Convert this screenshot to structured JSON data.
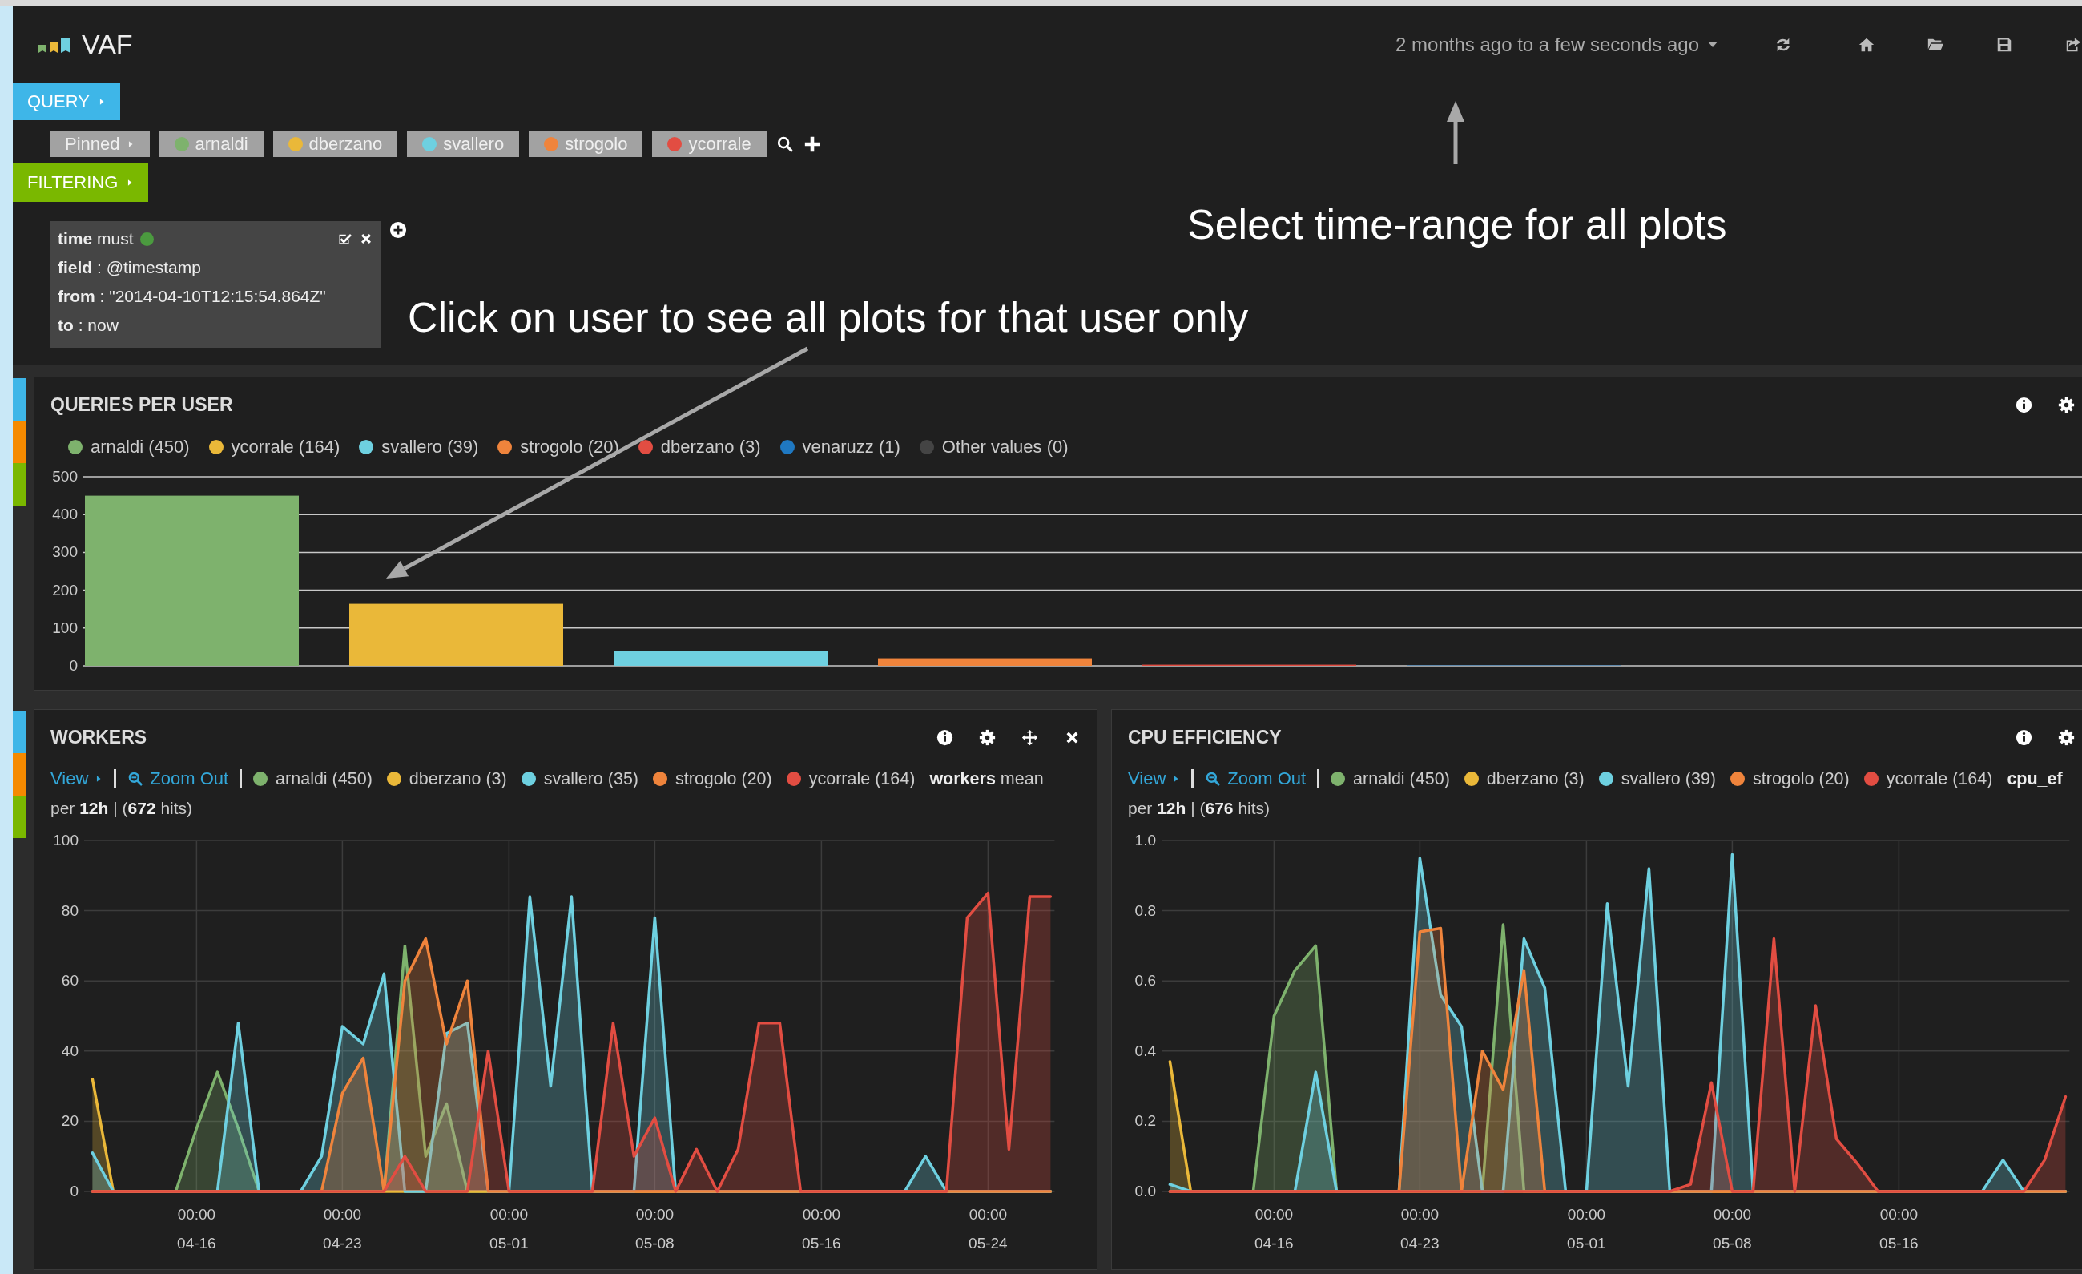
{
  "header": {
    "logo_text": "VAF",
    "time_range": "2 months ago to a few seconds ago"
  },
  "query": {
    "label": "QUERY"
  },
  "pinned": {
    "label": "Pinned",
    "queries": [
      {
        "label": "arnaldi",
        "color": "#7eb26d"
      },
      {
        "label": "dberzano",
        "color": "#eab839"
      },
      {
        "label": "svallero",
        "color": "#6ed0e0"
      },
      {
        "label": "strogolo",
        "color": "#ef843c"
      },
      {
        "label": "ycorrale",
        "color": "#e24d42"
      }
    ]
  },
  "filtering": {
    "label": "FILTERING"
  },
  "filters": [
    {
      "heading": "**time** must",
      "color": "#4b9a3f",
      "lines": [
        "**field** : @timestamp",
        "**from** : \"2014-04-10T12:15:54.864Z\"",
        "**to** : now"
      ]
    }
  ],
  "callouts": [
    {
      "text": "Select time-range for all plots"
    },
    {
      "text": "Click on user to see all plots for that user only"
    }
  ],
  "rows": [
    {
      "handles": [
        {
          "color": "#3eb6e8"
        },
        {
          "color": "#f58a00"
        },
        {
          "color": "#7ab800"
        }
      ],
      "panels": [
        {
          "kind": "bar",
          "title": "QUERIES PER USER",
          "hovered": false,
          "legend": [
            {
              "label": "arnaldi (450)",
              "color": "#7eb26d"
            },
            {
              "label": "ycorrale (164)",
              "color": "#eab839"
            },
            {
              "label": "svallero (39)",
              "color": "#6ed0e0"
            },
            {
              "label": "strogolo (20)",
              "color": "#ef843c"
            },
            {
              "label": "dberzano (3)",
              "color": "#e24d42"
            },
            {
              "label": "venaruzz (1)",
              "color": "#1f78c1"
            },
            {
              "label": "Other values (0)",
              "color": "#444444"
            }
          ],
          "chart_data": {
            "type": "bar",
            "grid": true,
            "values": [
              450,
              164,
              39,
              20,
              3,
              1,
              0
            ],
            "ylim": [
              0,
              500
            ],
            "yticks": [
              0,
              100,
              200,
              300,
              400,
              500
            ]
          }
        }
      ]
    },
    {
      "handles": [
        {
          "color": "#3eb6e8"
        },
        {
          "color": "#f58a00"
        },
        {
          "color": "#7ab800"
        }
      ],
      "panels": [
        {
          "kind": "histogram",
          "title": "WORKERS",
          "hovered": true,
          "view_label": "View",
          "zoom_label": "Zoom Out",
          "legend": [
            {
              "label": "arnaldi (450)",
              "color": "#7eb26d"
            },
            {
              "label": "dberzano (3)",
              "color": "#eab839"
            },
            {
              "label": "svallero (35)",
              "color": "#6ed0e0"
            },
            {
              "label": "strogolo (20)",
              "color": "#ef843c"
            },
            {
              "label": "ycorrale (164)",
              "color": "#e24d42"
            }
          ],
          "metric_text": "**workers** mean",
          "interval_text": "per **12h** | (**672** hits)",
          "chart_data": {
            "type": "area",
            "grid": true,
            "categories": [
              null,
              null,
              null,
              null,
              null,
              "00:00 04-16",
              null,
              null,
              null,
              null,
              null,
              null,
              "00:00 04-23",
              null,
              null,
              null,
              null,
              null,
              null,
              null,
              "00:00 05-01",
              null,
              null,
              null,
              null,
              null,
              null,
              "00:00 05-08",
              null,
              null,
              null,
              null,
              null,
              null,
              null,
              "00:00 05-16",
              null,
              null,
              null,
              null,
              null,
              null,
              null,
              "00:00 05-24",
              null,
              null,
              null
            ],
            "ylim": [
              0,
              100
            ],
            "yticks": [
              0,
              20,
              40,
              60,
              80,
              100
            ],
            "series": [
              {
                "color": "#7eb26d",
                "values": [
                  0,
                  0,
                  0,
                  0,
                  0,
                  18,
                  34,
                  18,
                  0,
                  0,
                  0,
                  0,
                  0,
                  0,
                  0,
                  70,
                  10,
                  25,
                  0,
                  0,
                  0,
                  0,
                  0,
                  0,
                  0,
                  0,
                  0,
                  0,
                  0,
                  0,
                  0,
                  0,
                  0,
                  0,
                  0,
                  0,
                  0,
                  0,
                  0,
                  0,
                  0,
                  0,
                  0,
                  0,
                  0,
                  0,
                  0
                ]
              },
              {
                "color": "#eab839",
                "values": [
                  32,
                  0,
                  0,
                  0,
                  0,
                  0,
                  0,
                  0,
                  0,
                  0,
                  0,
                  0,
                  0,
                  0,
                  0,
                  0,
                  0,
                  0,
                  0,
                  0,
                  0,
                  0,
                  0,
                  0,
                  0,
                  0,
                  0,
                  0,
                  0,
                  0,
                  0,
                  0,
                  0,
                  0,
                  0,
                  0,
                  0,
                  0,
                  0,
                  0,
                  0,
                  0,
                  0,
                  0,
                  0,
                  0,
                  0
                ]
              },
              {
                "color": "#6ed0e0",
                "values": [
                  11,
                  0,
                  0,
                  0,
                  0,
                  0,
                  0,
                  48,
                  0,
                  0,
                  0,
                  10,
                  47,
                  42,
                  62,
                  0,
                  0,
                  45,
                  48,
                  0,
                  0,
                  84,
                  30,
                  84,
                  0,
                  0,
                  0,
                  78,
                  0,
                  0,
                  0,
                  0,
                  0,
                  0,
                  0,
                  0,
                  0,
                  0,
                  0,
                  0,
                  10,
                  0,
                  0,
                  0,
                  0,
                  0,
                  0
                ]
              },
              {
                "color": "#ef843c",
                "values": [
                  0,
                  0,
                  0,
                  0,
                  0,
                  0,
                  0,
                  0,
                  0,
                  0,
                  0,
                  0,
                  28,
                  38,
                  0,
                  60,
                  72,
                  42,
                  60,
                  0,
                  0,
                  0,
                  0,
                  0,
                  0,
                  0,
                  0,
                  0,
                  0,
                  0,
                  0,
                  0,
                  0,
                  0,
                  0,
                  0,
                  0,
                  0,
                  0,
                  0,
                  0,
                  0,
                  0,
                  0,
                  0,
                  0,
                  0
                ]
              },
              {
                "color": "#e24d42",
                "values": [
                  0,
                  0,
                  0,
                  0,
                  0,
                  0,
                  0,
                  0,
                  0,
                  0,
                  0,
                  0,
                  0,
                  0,
                  0,
                  10,
                  0,
                  0,
                  0,
                  40,
                  0,
                  0,
                  0,
                  0,
                  0,
                  48,
                  10,
                  21,
                  0,
                  12,
                  0,
                  12,
                  48,
                  48,
                  0,
                  0,
                  0,
                  0,
                  0,
                  0,
                  0,
                  0,
                  78,
                  85,
                  12,
                  84,
                  84
                ]
              }
            ]
          }
        },
        {
          "kind": "histogram",
          "title": "CPU EFFICIENCY",
          "hovered": false,
          "view_label": "View",
          "zoom_label": "Zoom Out",
          "legend": [
            {
              "label": "arnaldi (450)",
              "color": "#7eb26d"
            },
            {
              "label": "dberzano (3)",
              "color": "#eab839"
            },
            {
              "label": "svallero (39)",
              "color": "#6ed0e0"
            },
            {
              "label": "strogolo (20)",
              "color": "#ef843c"
            },
            {
              "label": "ycorrale (164)",
              "color": "#e24d42"
            }
          ],
          "metric_text": "**cpu_ef**",
          "interval_text": "per **12h** | (**676** hits)",
          "chart_data": {
            "type": "area",
            "grid": true,
            "categories": [
              null,
              null,
              null,
              null,
              null,
              "00:00 04-16",
              null,
              null,
              null,
              null,
              null,
              null,
              "00:00 04-23",
              null,
              null,
              null,
              null,
              null,
              null,
              null,
              "00:00 05-01",
              null,
              null,
              null,
              null,
              null,
              null,
              "00:00 05-08",
              null,
              null,
              null,
              null,
              null,
              null,
              null,
              "00:00 05-16",
              null,
              null,
              null,
              null,
              null,
              null,
              null,
              null
            ],
            "ylim": [
              0,
              1
            ],
            "yticks": [
              {
                "value": 0,
                "label": "0.0"
              },
              {
                "value": 0.2,
                "label": "0.2"
              },
              {
                "value": 0.4,
                "label": "0.4"
              },
              {
                "value": 0.6,
                "label": "0.6"
              },
              {
                "value": 0.8,
                "label": "0.8"
              },
              {
                "value": 1,
                "label": "1.0"
              }
            ],
            "series": [
              {
                "color": "#7eb26d",
                "values": [
                  0,
                  0,
                  0,
                  0,
                  0,
                  0.5,
                  0.63,
                  0.7,
                  0,
                  0,
                  0,
                  0,
                  0,
                  0,
                  0,
                  0,
                  0.76,
                  0,
                  0,
                  0,
                  0,
                  0,
                  0,
                  0,
                  0,
                  0,
                  0,
                  0,
                  0,
                  0,
                  0,
                  0,
                  0,
                  0,
                  0,
                  0,
                  0,
                  0,
                  0,
                  0,
                  0,
                  0,
                  0,
                  0
                ]
              },
              {
                "color": "#eab839",
                "values": [
                  0.37,
                  0,
                  0,
                  0,
                  0,
                  0,
                  0,
                  0,
                  0,
                  0,
                  0,
                  0,
                  0,
                  0,
                  0,
                  0,
                  0,
                  0,
                  0,
                  0,
                  0,
                  0,
                  0,
                  0,
                  0,
                  0,
                  0,
                  0,
                  0,
                  0,
                  0,
                  0,
                  0,
                  0,
                  0,
                  0,
                  0,
                  0,
                  0,
                  0,
                  0,
                  0,
                  0,
                  0
                ]
              },
              {
                "color": "#6ed0e0",
                "values": [
                  0.02,
                  0,
                  0,
                  0,
                  0,
                  0,
                  0,
                  0.34,
                  0,
                  0,
                  0,
                  0,
                  0.95,
                  0.56,
                  0.47,
                  0,
                  0,
                  0.72,
                  0.58,
                  0,
                  0,
                  0.82,
                  0.3,
                  0.92,
                  0,
                  0,
                  0,
                  0.96,
                  0,
                  0,
                  0,
                  0,
                  0,
                  0,
                  0,
                  0,
                  0,
                  0,
                  0,
                  0,
                  0.09,
                  0,
                  0,
                  0
                ]
              },
              {
                "color": "#ef843c",
                "values": [
                  0,
                  0,
                  0,
                  0,
                  0,
                  0,
                  0,
                  0,
                  0,
                  0,
                  0,
                  0,
                  0.74,
                  0.75,
                  0,
                  0.4,
                  0.29,
                  0.63,
                  0,
                  0,
                  0,
                  0,
                  0,
                  0,
                  0,
                  0,
                  0,
                  0,
                  0,
                  0,
                  0,
                  0,
                  0,
                  0,
                  0,
                  0,
                  0,
                  0,
                  0,
                  0,
                  0,
                  0,
                  0,
                  0
                ]
              },
              {
                "color": "#e24d42",
                "values": [
                  0,
                  0,
                  0,
                  0,
                  0,
                  0,
                  0,
                  0,
                  0,
                  0,
                  0,
                  0,
                  0,
                  0,
                  0,
                  0,
                  0,
                  0,
                  0,
                  0,
                  0,
                  0,
                  0,
                  0,
                  0,
                  0.02,
                  0.31,
                  0,
                  0,
                  0.72,
                  0,
                  0.53,
                  0.15,
                  0.08,
                  0,
                  0,
                  0,
                  0,
                  0,
                  0,
                  0,
                  0,
                  0.09,
                  0.27
                ]
              }
            ]
          }
        }
      ]
    }
  ]
}
